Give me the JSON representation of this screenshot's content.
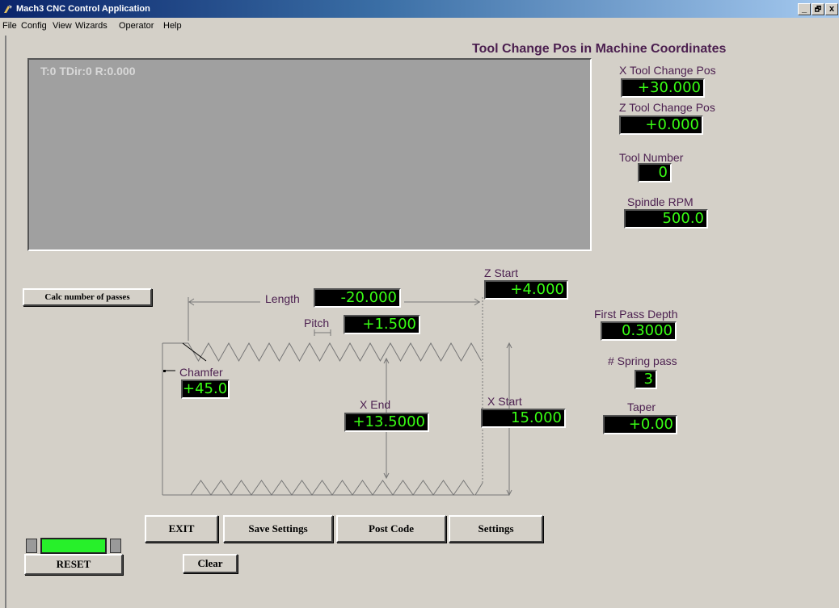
{
  "window": {
    "title": "Mach3 CNC Control Application",
    "controls": {
      "minimize": "_",
      "restore": "🗗",
      "close": "x"
    }
  },
  "menu": [
    "File",
    "Config",
    "View",
    "Wizards",
    "Operator",
    "Help"
  ],
  "toolpath": {
    "status": "T:0 TDir:0 R:0.000"
  },
  "tool_change": {
    "heading": "Tool Change Pos in Machine Coordinates",
    "x_label": "X Tool Change Pos",
    "x_value": "+30.000",
    "z_label": "Z Tool Change Pos",
    "z_value": "+0.000",
    "tool_number_label": "Tool Number",
    "tool_number_value": "0",
    "spindle_label": "Spindle RPM",
    "spindle_value": "500.0"
  },
  "thread": {
    "length_label": "Length",
    "length_value": "-20.000",
    "pitch_label": "Pitch",
    "pitch_value": "+1.500",
    "z_start_label": "Z Start",
    "z_start_value": "+4.000",
    "chamfer_label": "Chamfer",
    "chamfer_value": "+45.0",
    "x_end_label": "X End",
    "x_end_value": "+13.5000",
    "x_start_label": "X Start",
    "x_start_value": "15.000",
    "first_pass_label": "First Pass Depth",
    "first_pass_value": "0.3000",
    "spring_label": "# Spring pass",
    "spring_value": "3",
    "taper_label": "Taper",
    "taper_value": "+0.00"
  },
  "buttons": {
    "calc": "Calc number of passes",
    "exit": "EXIT",
    "save": "Save Settings",
    "post": "Post Code",
    "settings": "Settings",
    "reset": "RESET",
    "clear": "Clear"
  },
  "colors": {
    "label": "#4b1f4f",
    "dro_text": "#39ff14",
    "dro_bg": "#000000",
    "led": "#27f02a"
  }
}
